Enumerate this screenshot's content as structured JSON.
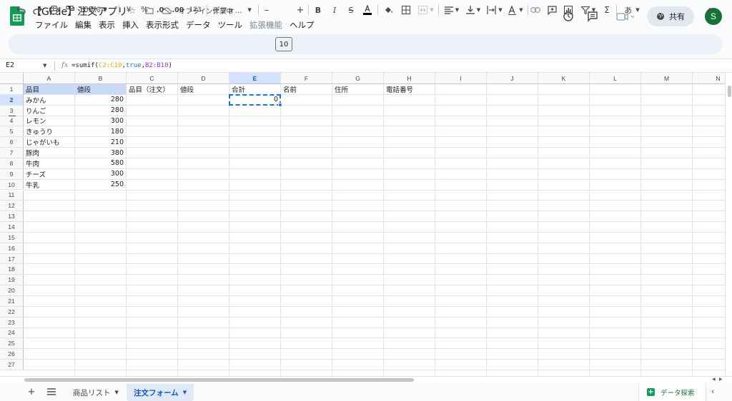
{
  "doc": {
    "title": "【Glide】注文アプリ",
    "offline_status": "オフライン作業中",
    "share_label": "共有",
    "avatar_initial": "S"
  },
  "menu": [
    "ファイル",
    "編集",
    "表示",
    "挿入",
    "表示形式",
    "データ",
    "ツール",
    "拡張機能",
    "ヘルプ"
  ],
  "toolbar": {
    "zoom": "100%",
    "currency": "¥",
    "percent": "%",
    "dec_decrease": ".0",
    "dec_increase": ".00",
    "number_format": "123",
    "font": "デフォ...",
    "font_size": "10",
    "input_tool": "あ"
  },
  "formula_bar": {
    "cell_ref": "E2",
    "fx": "fx",
    "formula_parts": {
      "p1": "=sumif(",
      "p2": "C2:C10",
      "p3": ",",
      "p4": "true",
      "p5": ",",
      "p6": "B2:B10",
      "p7": ")"
    }
  },
  "columns": [
    "A",
    "B",
    "C",
    "D",
    "E",
    "F",
    "G",
    "H",
    "I",
    "J",
    "K",
    "L",
    "M",
    "N"
  ],
  "rows": [
    "1",
    "2",
    "3",
    "4",
    "5",
    "6",
    "7",
    "8",
    "9",
    "10",
    "11",
    "12",
    "13",
    "14",
    "15",
    "16",
    "17",
    "18",
    "19",
    "20",
    "21",
    "22",
    "23",
    "24",
    "25",
    "26",
    "27"
  ],
  "cells": {
    "headers": {
      "A1": "品目",
      "B1": "値段",
      "C1": "品目（注文）",
      "D1": "値段",
      "E1": "合計",
      "F1": "名前",
      "G1": "住所",
      "H1": "電話番号"
    },
    "items": [
      "みかん",
      "りんご",
      "レモン",
      "きゅうり",
      "じゃがいも",
      "豚肉",
      "牛肉",
      "チーズ",
      "牛乳"
    ],
    "prices": [
      "280",
      "280",
      "300",
      "180",
      "210",
      "380",
      "580",
      "300",
      "250"
    ],
    "E2": "0"
  },
  "sheets": [
    {
      "name": "商品リスト",
      "active": false
    },
    {
      "name": "注文フォーム",
      "active": true
    }
  ],
  "explore_label": "データ探索",
  "colors": {
    "accent": "#1a73e8",
    "header_highlight": "#c9daf8",
    "brand_green": "#0f9d58"
  },
  "icons": [
    "sheets-logo-icon",
    "star-icon",
    "folder-move-icon",
    "cloud-offline-icon",
    "history-icon",
    "comment-icon",
    "meet-icon",
    "globe-icon",
    "undo-icon",
    "redo-icon",
    "print-icon",
    "paint-format-icon",
    "bold-icon",
    "italic-icon",
    "strikethrough-icon",
    "text-color-icon",
    "fill-color-icon",
    "borders-icon",
    "merge-icon",
    "align-icon",
    "valign-icon",
    "wrap-icon",
    "rotate-icon",
    "link-icon",
    "insert-comment-icon",
    "chart-icon",
    "filter-icon",
    "sum-icon",
    "collapse-toolbar-icon"
  ]
}
